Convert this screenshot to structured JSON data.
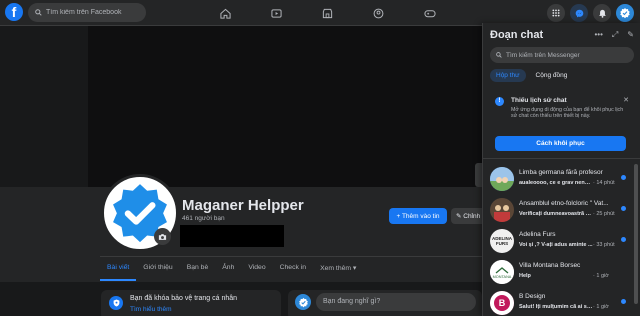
{
  "topbar": {
    "logo_letter": "f",
    "search_placeholder": "Tìm kiếm trên Facebook",
    "nav_icons": [
      "home-icon",
      "video-icon",
      "marketplace-icon",
      "groups-icon",
      "gaming-icon"
    ],
    "right_icons": [
      "menu-grid-icon",
      "messenger-icon",
      "bell-icon",
      "account-avatar"
    ]
  },
  "profile": {
    "name": "Maganer Helpper",
    "friends": "461 người bạn",
    "add_story_label": "+ Thêm vào tin",
    "edit_label": "✎ Chỉnh",
    "tabs": [
      "Bài viết",
      "Giới thiệu",
      "Bạn bè",
      "Ảnh",
      "Video",
      "Check in",
      "Xem thêm ▾"
    ]
  },
  "protect_card": {
    "title": "Bạn đã khóa bảo vệ trang cá nhân",
    "link": "Tìm hiểu thêm"
  },
  "composer": {
    "placeholder": "Bạn đang nghĩ gì?"
  },
  "chat": {
    "title": "Đoạn chat",
    "actions": [
      "•••",
      "⤢",
      "✎"
    ],
    "search_placeholder": "Tìm kiếm trên Messenger",
    "tabs": [
      "Hộp thư",
      "Cộng đồng"
    ],
    "notice": {
      "title": "Thiếu lịch sử chat",
      "body": "Mở ứng dụng di động của bạn để khôi phục lịch sử chat còn thiếu trên thiết bị này.",
      "button": "Cách khôi phục"
    },
    "conversations": [
      {
        "name": "Limba germana fără profesor",
        "message": "aualeoooo, ce e grav nenea...",
        "time": "· 14 phút",
        "avatar_color": "#4a90d9"
      },
      {
        "name": "Ansamblul etno-folcloric \" Vat...",
        "message": "Verificați dumneavoastră și...",
        "time": "· 25 phút",
        "avatar_color": "#2b2b2b"
      },
      {
        "name": "Adelina Furs",
        "message": "Voi și ,? V-ați adus aminte ...",
        "time": "· 33 phút",
        "avatar_color": "#1a1a1a"
      },
      {
        "name": "Villa Montana Borsec",
        "message": "Help",
        "time": "· 1 giờ",
        "avatar_color": "#e8e8e8"
      },
      {
        "name": "B Design",
        "message": "Salut! Îți mulțumim că ai scris...",
        "time": "· 1 giờ",
        "avatar_color": "#c2185b"
      }
    ]
  }
}
